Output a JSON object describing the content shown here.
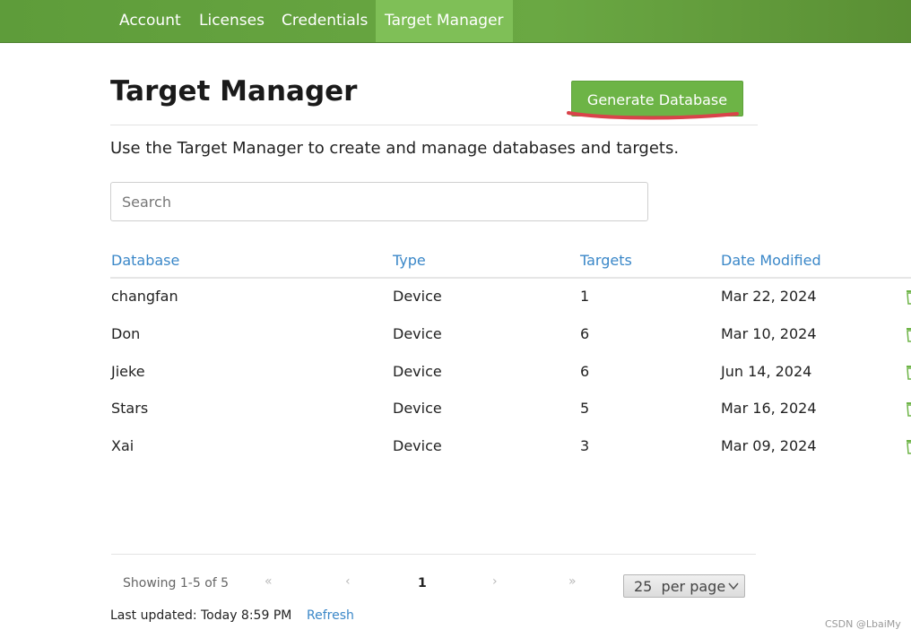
{
  "nav": {
    "items": [
      {
        "label": "Account",
        "active": false
      },
      {
        "label": "Licenses",
        "active": false
      },
      {
        "label": "Credentials",
        "active": false
      },
      {
        "label": "Target Manager",
        "active": true
      }
    ]
  },
  "page": {
    "title": "Target Manager",
    "generate_button": "Generate Database",
    "description": "Use the Target Manager to create and manage databases and targets."
  },
  "search": {
    "placeholder": "Search",
    "value": ""
  },
  "table": {
    "columns": [
      "Database",
      "Type",
      "Targets",
      "Date Modified"
    ],
    "rows": [
      {
        "database": "changfan",
        "type": "Device",
        "targets": "1",
        "date": "Mar 22, 2024"
      },
      {
        "database": "Don",
        "type": "Device",
        "targets": "6",
        "date": "Mar 10, 2024"
      },
      {
        "database": "Jieke",
        "type": "Device",
        "targets": "6",
        "date": "Jun 14, 2024"
      },
      {
        "database": "Stars",
        "type": "Device",
        "targets": "5",
        "date": "Mar 16, 2024"
      },
      {
        "database": "Xai",
        "type": "Device",
        "targets": "3",
        "date": "Mar 09, 2024"
      }
    ]
  },
  "pagination": {
    "showing": "Showing 1-5 of 5",
    "first": "«",
    "prev": "‹",
    "current_page": "1",
    "next": "›",
    "last": "»",
    "per_page_value": "25",
    "per_page_suffix": "per page"
  },
  "footer": {
    "last_updated": "Last updated: Today 8:59 PM",
    "refresh": "Refresh"
  },
  "watermark": "CSDN @LbaiMy",
  "icons": {
    "row_action": "trash-icon",
    "per_page_toggle": "chevron-down-icon"
  },
  "colors": {
    "accent": "#6db446",
    "link": "#3a87c8",
    "annotation": "#d9434a"
  }
}
